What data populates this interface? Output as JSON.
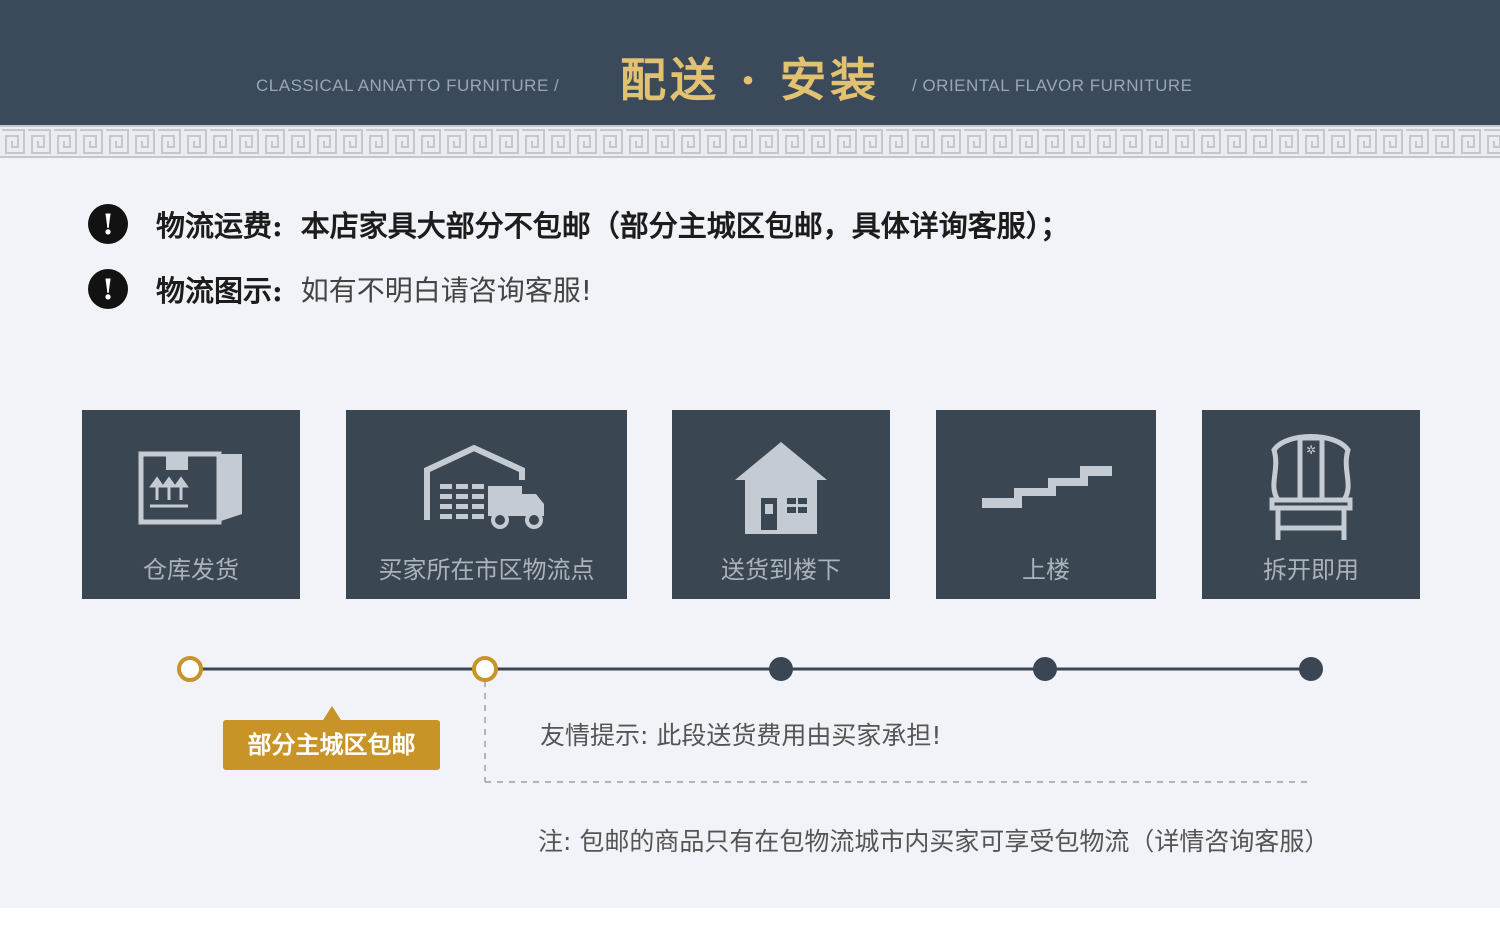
{
  "header": {
    "title": "配送 · 安装",
    "subtitle_left": "CLASSICAL ANNATTO FURNITURE /",
    "subtitle_right": "/ ORIENTAL FLAVOR FURNITURE"
  },
  "notices": [
    {
      "label": "物流运费:",
      "text": "本店家具大部分不包邮（部分主城区包邮，具体详询客服）；"
    },
    {
      "label": "物流图示:",
      "text": "如有不明白请咨询客服!"
    }
  ],
  "steps": [
    {
      "label": "仓库发货",
      "icon": "box-icon"
    },
    {
      "label": "买家所在市区物流点",
      "icon": "warehouse-truck-icon"
    },
    {
      "label": "送货到楼下",
      "icon": "house-icon"
    },
    {
      "label": "上楼",
      "icon": "stairs-icon"
    },
    {
      "label": "拆开即用",
      "icon": "chair-icon"
    }
  ],
  "badge": "部分主城区包邮",
  "tip": "友情提示:  此段送货费用由买家承担!",
  "note": "注:  包邮的商品只有在包物流城市内买家可享受包物流（详情咨询客服）",
  "colors": {
    "banner": "#3a4a5b",
    "gold": "#e2c270",
    "accent": "#c99427",
    "card": "#3b4653"
  }
}
